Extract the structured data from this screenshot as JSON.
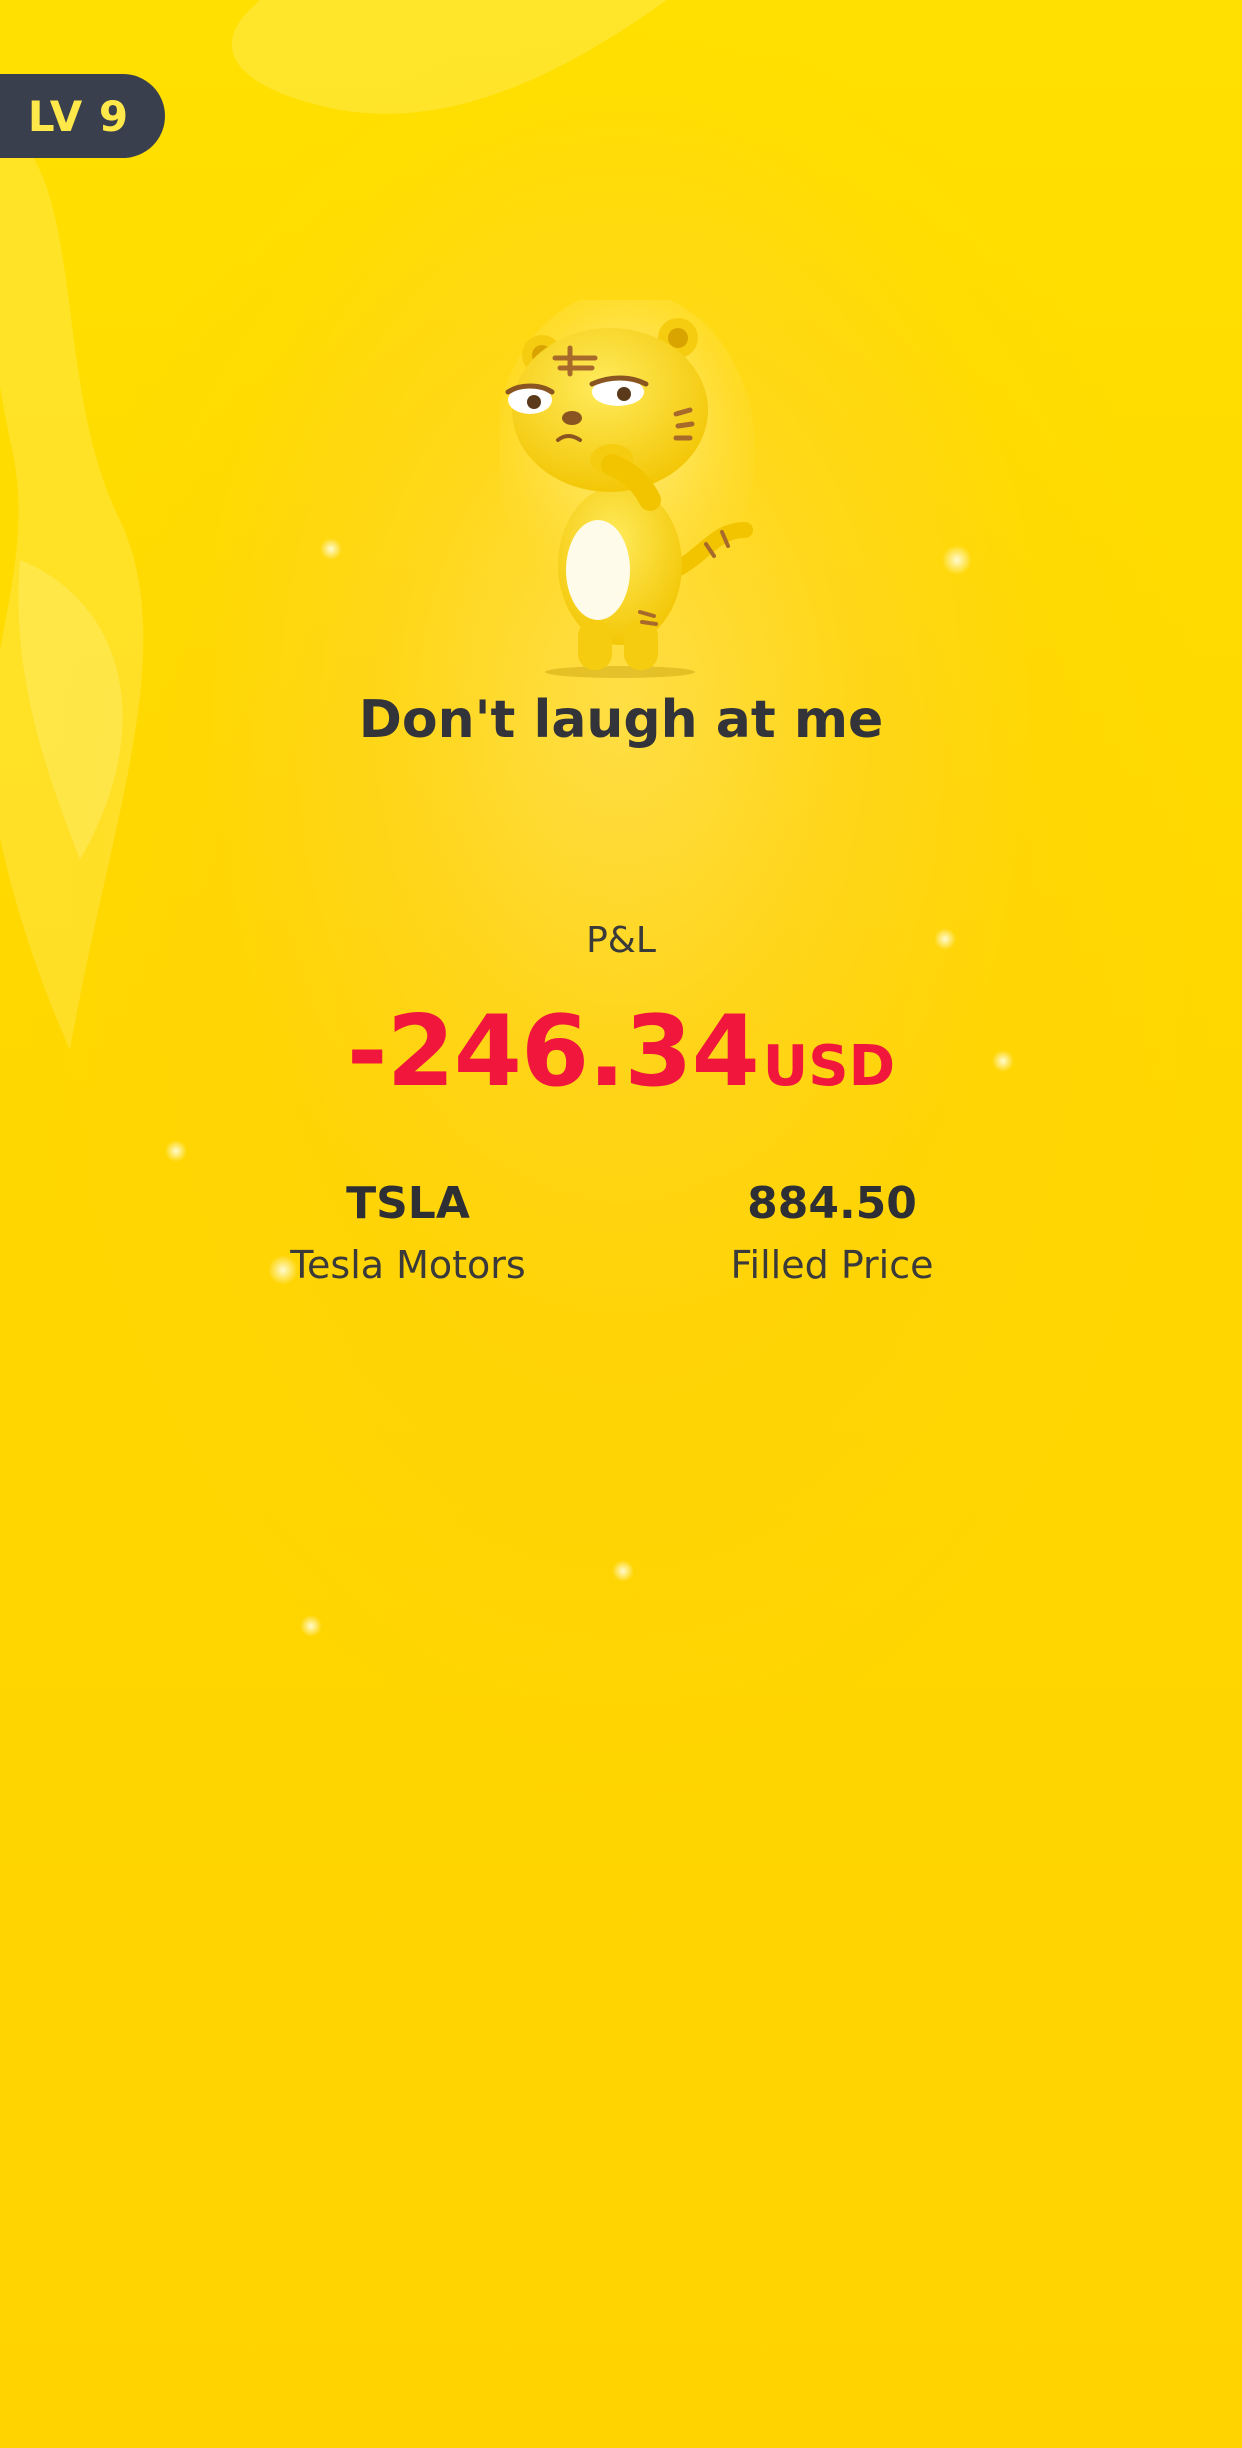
{
  "level_badge": {
    "label": "LV 9"
  },
  "mood": {
    "title": "Don't laugh at me",
    "mascot": "tiger-mascot"
  },
  "pnl": {
    "label": "P&L",
    "amount": "-246.34",
    "currency": "USD",
    "color": "#F0163C"
  },
  "position": {
    "symbol": "TSLA",
    "name": "Tesla Motors",
    "price": "884.50",
    "price_label": "Filled Price"
  },
  "colors": {
    "background": "#FFD400",
    "badge_bg": "#3A3F4E",
    "badge_text": "#FFE84A"
  }
}
